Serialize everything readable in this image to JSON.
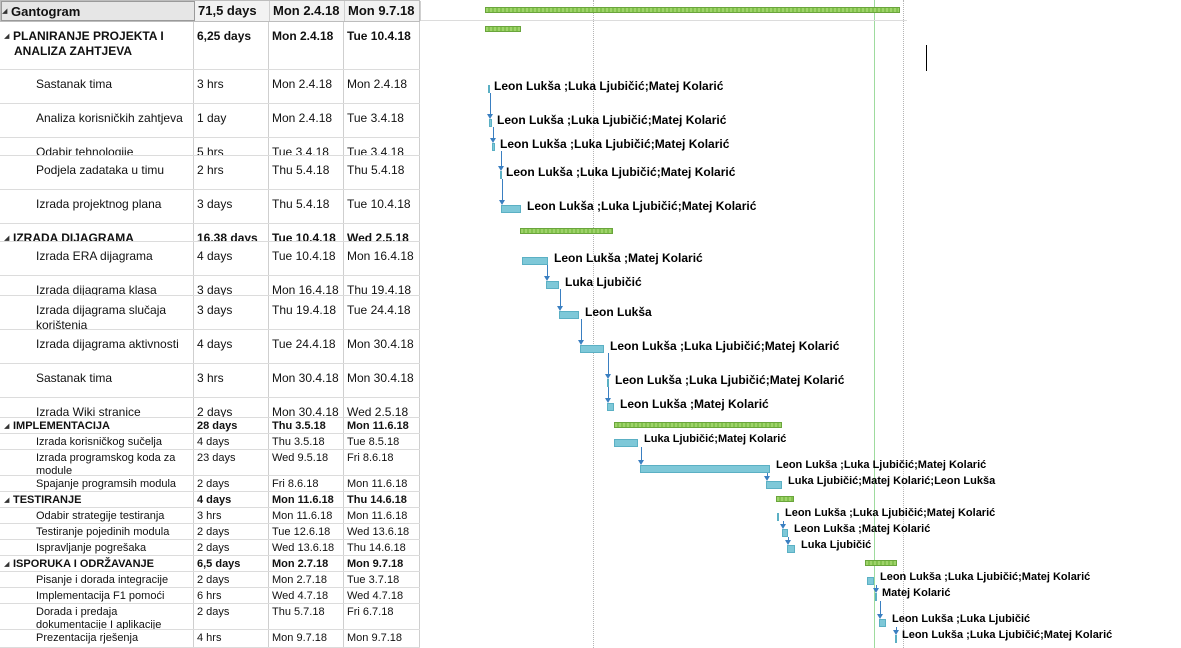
{
  "project": {
    "name": "Gantogram",
    "duration": "71,5 days",
    "start": "Mon 2.4.18",
    "finish": "Mon 9.7.18"
  },
  "tasks": [
    {
      "name": "PLANIRANJE PROJEKTA I ANALIZA ZAHTJEVA",
      "duration": "6,25 days",
      "start": "Mon 2.4.18",
      "finish": "Tue 10.4.18",
      "summary": true,
      "resources": ""
    },
    {
      "name": "Sastanak tima",
      "duration": "3 hrs",
      "start": "Mon 2.4.18",
      "finish": "Mon 2.4.18",
      "summary": false,
      "resources": "Leon Lukša ;Luka Ljubičić;Matej Kolarić"
    },
    {
      "name": "Analiza korisničkih zahtjeva",
      "duration": "1 day",
      "start": "Mon 2.4.18",
      "finish": "Tue 3.4.18",
      "summary": false,
      "resources": "Leon Lukša ;Luka Ljubičić;Matej Kolarić"
    },
    {
      "name": "Odabir tehnologije",
      "duration": "5 hrs",
      "start": "Tue 3.4.18",
      "finish": "Tue 3.4.18",
      "summary": false,
      "resources": "Leon Lukša ;Luka Ljubičić;Matej Kolarić"
    },
    {
      "name": "Podjela zadataka u timu",
      "duration": "2 hrs",
      "start": "Thu 5.4.18",
      "finish": "Thu 5.4.18",
      "summary": false,
      "resources": "Leon Lukša ;Luka Ljubičić;Matej Kolarić"
    },
    {
      "name": "Izrada projektnog plana",
      "duration": "3 days",
      "start": "Thu 5.4.18",
      "finish": "Tue 10.4.18",
      "summary": false,
      "resources": "Leon Lukša ;Luka Ljubičić;Matej Kolarić"
    },
    {
      "name": "IZRADA DIJAGRAMA",
      "duration": "16,38 days",
      "start": "Tue 10.4.18",
      "finish": "Wed 2.5.18",
      "summary": true,
      "resources": ""
    },
    {
      "name": "Izrada ERA dijagrama",
      "duration": "4 days",
      "start": "Tue 10.4.18",
      "finish": "Mon 16.4.18",
      "summary": false,
      "resources": "Leon Lukša ;Matej Kolarić"
    },
    {
      "name": "Izrada dijagrama klasa",
      "duration": "3 days",
      "start": "Mon 16.4.18",
      "finish": "Thu 19.4.18",
      "summary": false,
      "resources": "Luka Ljubičić"
    },
    {
      "name": "Izrada dijagrama slučaja korištenja",
      "duration": "3 days",
      "start": "Thu 19.4.18",
      "finish": "Tue 24.4.18",
      "summary": false,
      "resources": "Leon Lukša"
    },
    {
      "name": "Izrada dijagrama aktivnosti",
      "duration": "4 days",
      "start": "Tue 24.4.18",
      "finish": "Mon 30.4.18",
      "summary": false,
      "resources": "Leon Lukša ;Luka Ljubičić;Matej Kolarić"
    },
    {
      "name": "Sastanak tima",
      "duration": "3 hrs",
      "start": "Mon 30.4.18",
      "finish": "Mon 30.4.18",
      "summary": false,
      "resources": "Leon Lukša ;Luka Ljubičić;Matej Kolarić"
    },
    {
      "name": "Izrada Wiki stranice",
      "duration": "2 days",
      "start": "Mon 30.4.18",
      "finish": "Wed 2.5.18",
      "summary": false,
      "resources": "Leon Lukša ;Matej Kolarić"
    },
    {
      "name": "IMPLEMENTACIJA",
      "duration": "28 days",
      "start": "Thu 3.5.18",
      "finish": "Mon 11.6.18",
      "summary": true,
      "resources": ""
    },
    {
      "name": "Izrada korisničkog sučelja",
      "duration": "4 days",
      "start": "Thu 3.5.18",
      "finish": "Tue 8.5.18",
      "summary": false,
      "resources": "Luka Ljubičić;Matej Kolarić"
    },
    {
      "name": "Izrada programskog koda za module",
      "duration": "23 days",
      "start": "Wed 9.5.18",
      "finish": "Fri 8.6.18",
      "summary": false,
      "resources": "Leon Lukša ;Luka Ljubičić;Matej Kolarić"
    },
    {
      "name": "Spajanje programsih modula",
      "duration": "2 days",
      "start": "Fri 8.6.18",
      "finish": "Mon 11.6.18",
      "summary": false,
      "resources": "Luka Ljubičić;Matej Kolarić;Leon Lukša"
    },
    {
      "name": "TESTIRANJE",
      "duration": "4 days",
      "start": "Mon 11.6.18",
      "finish": "Thu 14.6.18",
      "summary": true,
      "resources": ""
    },
    {
      "name": "Odabir strategije testiranja",
      "duration": "3 hrs",
      "start": "Mon 11.6.18",
      "finish": "Mon 11.6.18",
      "summary": false,
      "resources": "Leon Lukša ;Luka Ljubičić;Matej Kolarić"
    },
    {
      "name": "Testiranje pojedinih modula",
      "duration": "2 days",
      "start": "Tue 12.6.18",
      "finish": "Wed 13.6.18",
      "summary": false,
      "resources": "Leon Lukša ;Matej Kolarić"
    },
    {
      "name": "Ispravljanje pogrešaka",
      "duration": "2 days",
      "start": "Wed 13.6.18",
      "finish": "Thu 14.6.18",
      "summary": false,
      "resources": "Luka Ljubičić"
    },
    {
      "name": "ISPORUKA I ODRŽAVANJE",
      "duration": "6,5 days",
      "start": "Mon 2.7.18",
      "finish": "Mon 9.7.18",
      "summary": true,
      "resources": ""
    },
    {
      "name": "Pisanje i dorada integracije",
      "duration": "2 days",
      "start": "Mon 2.7.18",
      "finish": "Tue 3.7.18",
      "summary": false,
      "resources": "Leon Lukša ;Luka Ljubičić;Matej Kolarić"
    },
    {
      "name": "Implementacija F1 pomoći",
      "duration": "6 hrs",
      "start": "Wed 4.7.18",
      "finish": "Wed 4.7.18",
      "summary": false,
      "resources": "Matej Kolarić"
    },
    {
      "name": "Dorada i predaja dokumentacije I aplikacije",
      "duration": "2 days",
      "start": "Thu 5.7.18",
      "finish": "Fri 6.7.18",
      "summary": false,
      "resources": "Leon Lukša ;Luka Ljubičić"
    },
    {
      "name": "Prezentacija rješenja",
      "duration": "4 hrs",
      "start": "Mon 9.7.18",
      "finish": "Mon 9.7.18",
      "summary": false,
      "resources": "Leon Lukša ;Luka Ljubičić;Matej Kolarić"
    }
  ],
  "colors": {
    "task_bar": "#7ec8d8",
    "summary_bar": "#9ed36a",
    "link": "#3a7fc1"
  }
}
